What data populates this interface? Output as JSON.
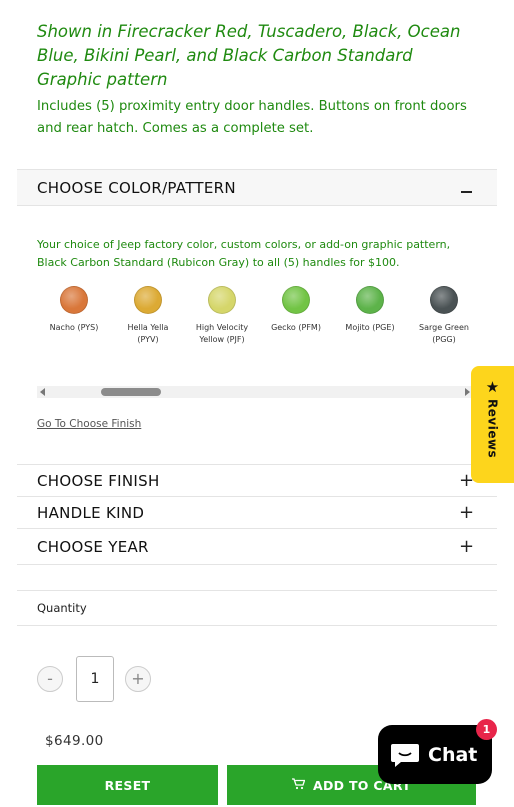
{
  "headline": "Shown in Firecracker Red, Tuscadero, Black, Ocean Blue, Bikini Pearl, and Black Carbon Standard Graphic pattern",
  "includes": "Includes (5) proximity entry door handles. Buttons on front doors and rear hatch. Comes as a complete set.",
  "color_section": {
    "title": "CHOOSE COLOR/PATTERN",
    "description": "Your choice of Jeep factory color, custom colors, or add-on graphic pattern, Black Carbon Standard (Rubicon Gray) to all (5) handles for $100.",
    "swatches": [
      {
        "name": "Nacho (PYS)",
        "color": "#d9773a"
      },
      {
        "name": "Hella Yella\n(PYV)",
        "color": "#dcaa34"
      },
      {
        "name": "High Velocity\nYellow (PJF)",
        "color": "#d5d66a"
      },
      {
        "name": "Gecko (PFM)",
        "color": "#72c445"
      },
      {
        "name": "Mojito (PGE)",
        "color": "#5db34a"
      },
      {
        "name": "Sarge Green\n(PGG)",
        "color": "#4a5254"
      }
    ],
    "goto_link": "Go To Choose Finish"
  },
  "sections": {
    "finish": "CHOOSE FINISH",
    "handle_kind": "HANDLE KIND",
    "year": "CHOOSE YEAR"
  },
  "quantity": {
    "label": "Quantity",
    "value": "1",
    "minus": "-",
    "plus": "+"
  },
  "price": "$649.00",
  "buttons": {
    "reset": "RESET",
    "add_to_cart": "ADD TO CART"
  },
  "reviews_tab": "Reviews",
  "chat": {
    "label": "Chat",
    "badge": "1"
  },
  "colors": {
    "accent_green": "#2aa52a",
    "text_green": "#1f8a10",
    "reviews_yellow": "#fdd51c"
  }
}
